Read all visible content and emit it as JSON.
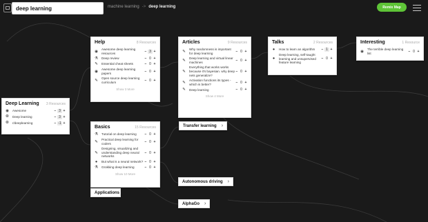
{
  "topbar": {
    "search_value": "deep learning",
    "breadcrumb": [
      "machine learning",
      "deep learning"
    ],
    "breadcrumb_sep": "->",
    "cta_label": "Remix Map",
    "accent": "#5ec437"
  },
  "cards": {
    "help": {
      "title": "Help",
      "count": "8 Resources",
      "items": [
        {
          "icon": "github-icon",
          "glyph": "◉",
          "text": "Awesome deep learning resources",
          "score": "3",
          "hot": true
        },
        {
          "icon": "flask-icon",
          "glyph": "⚗",
          "text": "Deep review",
          "score": "0"
        },
        {
          "icon": "pencil-icon",
          "glyph": "✎",
          "text": "Essential cheat sheets",
          "score": "0"
        },
        {
          "icon": "github-icon",
          "glyph": "◉",
          "text": "Awesome deep learning papers",
          "score": "0"
        },
        {
          "icon": "pencil-icon",
          "glyph": "✎",
          "text": "Open source deep learning curriculum",
          "score": "0"
        }
      ],
      "more": "Show 3 More"
    },
    "articles": {
      "title": "Articles",
      "count": "9 Resources",
      "items": [
        {
          "icon": "pencil-icon",
          "glyph": "✎",
          "text": "Why randomness is important for deep learning",
          "score": "0"
        },
        {
          "icon": "pencil-icon",
          "glyph": "✎",
          "text": "Deep learning and virtual linear machines",
          "score": "0"
        },
        {
          "icon": "pencil-icon",
          "glyph": "✎",
          "text": "Everything that works works because it's bayesian. why deep nets generalize?",
          "score": "0"
        },
        {
          "icon": "pencil-icon",
          "glyph": "✎",
          "text": "Activation functions its types - which is better?",
          "score": "0"
        },
        {
          "icon": "pencil-icon",
          "glyph": "✎",
          "text": "Deep learning",
          "score": "0"
        }
      ],
      "more": "Show 4 More"
    },
    "talks": {
      "title": "Talks",
      "count": "2 Resources",
      "items": [
        {
          "icon": "play-icon",
          "glyph": "●",
          "text": "How to learn an algorithm",
          "score": "1",
          "hot": true
        },
        {
          "icon": "play-icon",
          "glyph": "●",
          "text": "Deep learning, self-taught learning and unsupervised feature learning",
          "score": "0"
        }
      ]
    },
    "interesting": {
      "title": "Interesting",
      "count": "1 Resource",
      "items": [
        {
          "icon": "github-icon",
          "glyph": "◉",
          "text": "The terrible deep learning list",
          "score": "0"
        }
      ]
    },
    "deep_learning": {
      "title": "Deep Learning",
      "count": "3 Resources",
      "items": [
        {
          "icon": "github-icon",
          "glyph": "◉",
          "text": "Awesome",
          "score": "3",
          "hot": true
        },
        {
          "icon": "link-icon",
          "glyph": "⦾",
          "text": "Deep learning",
          "score": "3",
          "hot": true
        },
        {
          "icon": "link-icon",
          "glyph": "⦾",
          "text": "r/deeplearning",
          "score": "-1",
          "hot": true
        }
      ]
    },
    "basics": {
      "title": "Basics",
      "count": "15 Resources",
      "items": [
        {
          "icon": "flask-icon",
          "glyph": "⚗",
          "text": "Tutorial on deep learning",
          "score": "0"
        },
        {
          "icon": "pencil-icon",
          "glyph": "✎",
          "text": "Practical deep learning for coders",
          "score": "0"
        },
        {
          "icon": "pencil-icon",
          "glyph": "✎",
          "text": "Designing, visualizing and understanding deep neural networks",
          "score": "0"
        },
        {
          "icon": "play-icon",
          "glyph": "●",
          "text": "But what is a neural network?",
          "score": "0"
        },
        {
          "icon": "flask-icon",
          "glyph": "⚗",
          "text": "Grokking deep learning",
          "score": "0"
        }
      ],
      "more": "Show 10 More"
    }
  },
  "pills": {
    "transfer": {
      "label": "Transfer learning",
      "chev": "›"
    },
    "autonomous": {
      "label": "Autonomous driving",
      "chev": "›"
    },
    "alphago": {
      "label": "AlphaGo",
      "chev": "›"
    },
    "applications": {
      "label": "Applications"
    }
  },
  "vote": {
    "minus": "−",
    "plus": "+"
  }
}
